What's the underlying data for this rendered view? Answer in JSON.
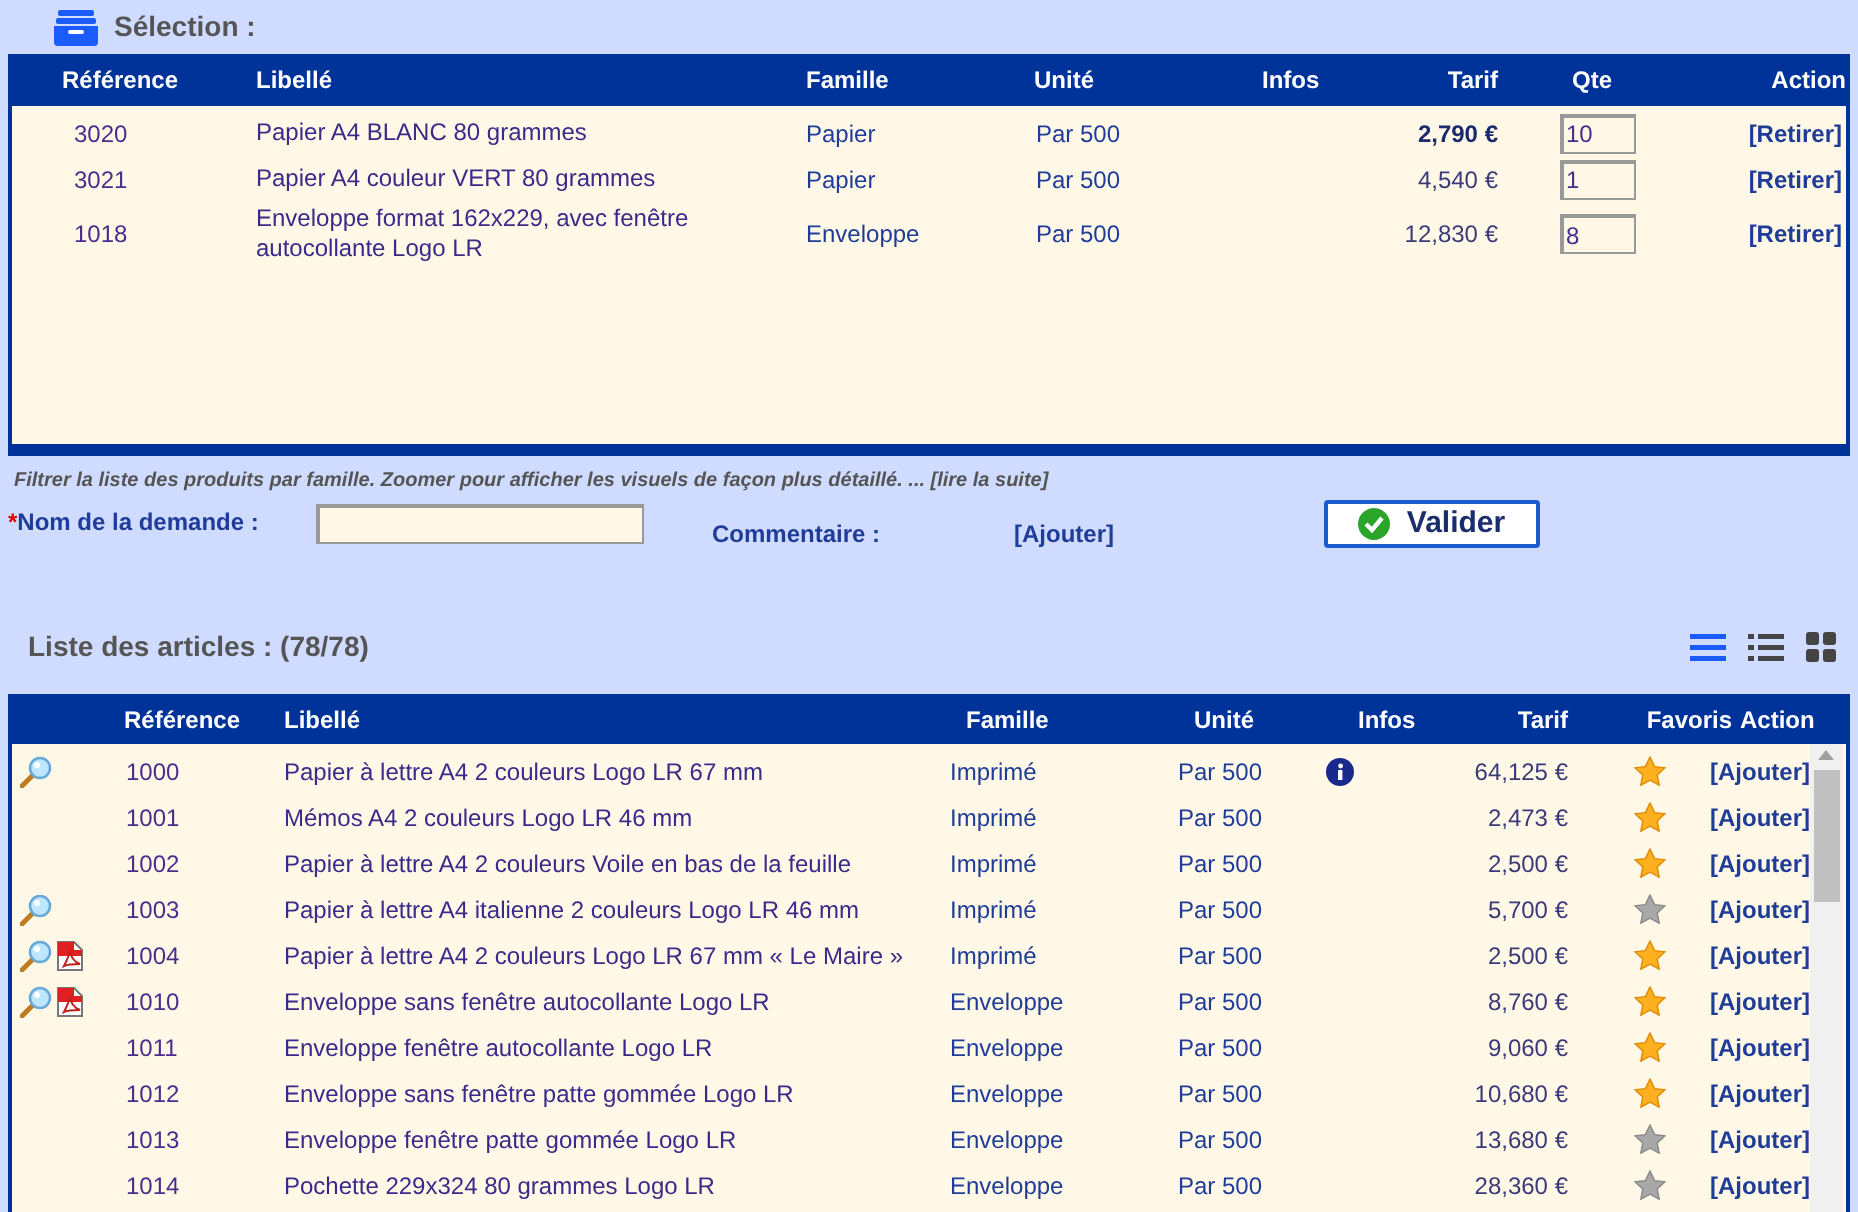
{
  "selection": {
    "title": "Sélection :",
    "columns": [
      "Référence",
      "Libellé",
      "Famille",
      "Unité",
      "Infos",
      "Tarif",
      "Qte",
      "Action"
    ],
    "rows": [
      {
        "reference": "3020",
        "label": "Papier A4 BLANC 80 grammes",
        "family": "Papier",
        "unit": "Par 500",
        "price": "2,790 €",
        "price_bold": true,
        "qty": "10",
        "action": "[Retirer]"
      },
      {
        "reference": "3021",
        "label": "Papier A4 couleur VERT 80 grammes",
        "family": "Papier",
        "unit": "Par 500",
        "price": "4,540 €",
        "price_bold": false,
        "qty": "1",
        "action": "[Retirer]"
      },
      {
        "reference": "1018",
        "label": "Enveloppe format 162x229, avec fenêtre autocollante Logo LR",
        "family": "Enveloppe",
        "unit": "Par 500",
        "price": "12,830 €",
        "price_bold": false,
        "qty": "8",
        "action": "[Retirer]"
      }
    ]
  },
  "hint": "Filtrer la liste des produits par famille. Zoomer pour afficher les visuels de façon plus détaillé. ... [lire la suite]",
  "form": {
    "required_mark": "*",
    "name_label": "Nom de la demande :",
    "comment_label": "Commentaire :",
    "comment_link": "[Ajouter]",
    "submit": "Valider"
  },
  "articles": {
    "title": "Liste des articles : (78/78)",
    "views": [
      {
        "kind": "list",
        "selected": true
      },
      {
        "kind": "detail",
        "selected": false
      },
      {
        "kind": "grid",
        "selected": false
      }
    ],
    "columns": [
      "Référence",
      "Libellé",
      "Famille",
      "Unité",
      "Infos",
      "Tarif",
      "Favoris",
      "Action"
    ],
    "rows": [
      {
        "zoom": true,
        "pdf": false,
        "reference": "1000",
        "label": "Papier à lettre A4 2 couleurs Logo LR 67 mm",
        "family": "Imprimé",
        "unit": "Par 500",
        "info": true,
        "price": "64,125 €",
        "favorite": true,
        "action": "[Ajouter]"
      },
      {
        "zoom": false,
        "pdf": false,
        "reference": "1001",
        "label": "Mémos A4 2 couleurs Logo LR 46 mm",
        "family": "Imprimé",
        "unit": "Par 500",
        "info": false,
        "price": "2,473 €",
        "favorite": true,
        "action": "[Ajouter]"
      },
      {
        "zoom": false,
        "pdf": false,
        "reference": "1002",
        "label": "Papier à lettre A4 2 couleurs Voile en bas de la feuille",
        "family": "Imprimé",
        "unit": "Par 500",
        "info": false,
        "price": "2,500 €",
        "favorite": true,
        "action": "[Ajouter]"
      },
      {
        "zoom": true,
        "pdf": false,
        "reference": "1003",
        "label": "Papier à lettre A4 italienne 2 couleurs Logo LR 46 mm",
        "family": "Imprimé",
        "unit": "Par 500",
        "info": false,
        "price": "5,700 €",
        "favorite": false,
        "action": "[Ajouter]"
      },
      {
        "zoom": true,
        "pdf": true,
        "reference": "1004",
        "label": "Papier à lettre A4 2 couleurs Logo LR 67 mm « Le Maire »",
        "family": "Imprimé",
        "unit": "Par 500",
        "info": false,
        "price": "2,500 €",
        "favorite": true,
        "action": "[Ajouter]"
      },
      {
        "zoom": true,
        "pdf": true,
        "reference": "1010",
        "label": "Enveloppe sans fenêtre autocollante Logo LR",
        "family": "Enveloppe",
        "unit": "Par 500",
        "info": false,
        "price": "8,760 €",
        "favorite": true,
        "action": "[Ajouter]"
      },
      {
        "zoom": false,
        "pdf": false,
        "reference": "1011",
        "label": "Enveloppe fenêtre autocollante Logo LR",
        "family": "Enveloppe",
        "unit": "Par 500",
        "info": false,
        "price": "9,060 €",
        "favorite": true,
        "action": "[Ajouter]"
      },
      {
        "zoom": false,
        "pdf": false,
        "reference": "1012",
        "label": "Enveloppe sans fenêtre patte gommée Logo LR",
        "family": "Enveloppe",
        "unit": "Par 500",
        "info": false,
        "price": "10,680 €",
        "favorite": true,
        "action": "[Ajouter]"
      },
      {
        "zoom": false,
        "pdf": false,
        "reference": "1013",
        "label": "Enveloppe fenêtre patte gommée Logo LR",
        "family": "Enveloppe",
        "unit": "Par 500",
        "info": false,
        "price": "13,680 €",
        "favorite": false,
        "action": "[Ajouter]"
      },
      {
        "zoom": false,
        "pdf": false,
        "reference": "1014",
        "label": "Pochette 229x324 80 grammes Logo LR",
        "family": "Enveloppe",
        "unit": "Par 500",
        "info": false,
        "price": "28,360 €",
        "favorite": false,
        "action": "[Ajouter]"
      }
    ]
  }
}
